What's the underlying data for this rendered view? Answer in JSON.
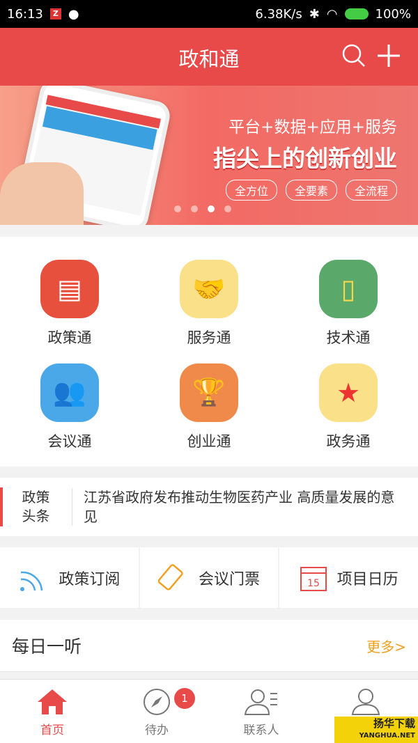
{
  "status": {
    "time": "16:13",
    "speed": "6.38K/s",
    "battery": "100%"
  },
  "header": {
    "title": "政和通",
    "search_icon": "search-icon",
    "add_icon": "plus-icon"
  },
  "banner": {
    "line1": "平台+数据+应用+服务",
    "line2": "指尖上的创新创业",
    "pills": [
      "全方位",
      "全要素",
      "全流程"
    ],
    "active_dot": 3,
    "dot_count": 4
  },
  "grid": [
    {
      "label": "政策通",
      "color": "#e8503e",
      "icon": "document-icon"
    },
    {
      "label": "服务通",
      "color": "#fbe08a",
      "icon": "handshake-icon"
    },
    {
      "label": "技术通",
      "color": "#5aa96a",
      "icon": "phone-tech-icon"
    },
    {
      "label": "会议通",
      "color": "#4aa8e8",
      "icon": "meeting-icon"
    },
    {
      "label": "创业通",
      "color": "#f08a4a",
      "icon": "trophy-icon"
    },
    {
      "label": "政务通",
      "color": "#fbe08a",
      "icon": "tiananmen-icon"
    }
  ],
  "news": {
    "tag_line1": "政策",
    "tag_line2": "头条",
    "text": "江苏省政府发布推动生物医药产业 高质量发展的意见"
  },
  "shortcuts": [
    {
      "label": "政策订阅",
      "icon": "rss-icon"
    },
    {
      "label": "会议门票",
      "icon": "ticket-icon"
    },
    {
      "label": "项目日历",
      "icon": "calendar-icon",
      "day": "15"
    }
  ],
  "daily": {
    "title": "每日一听",
    "more": "更多>"
  },
  "tabs": [
    {
      "label": "首页",
      "active": true
    },
    {
      "label": "待办",
      "badge": "1"
    },
    {
      "label": "联系人"
    },
    {
      "label": ""
    }
  ],
  "watermark": {
    "cn": "扬华下载",
    "en": "YANGHUA.NET"
  }
}
